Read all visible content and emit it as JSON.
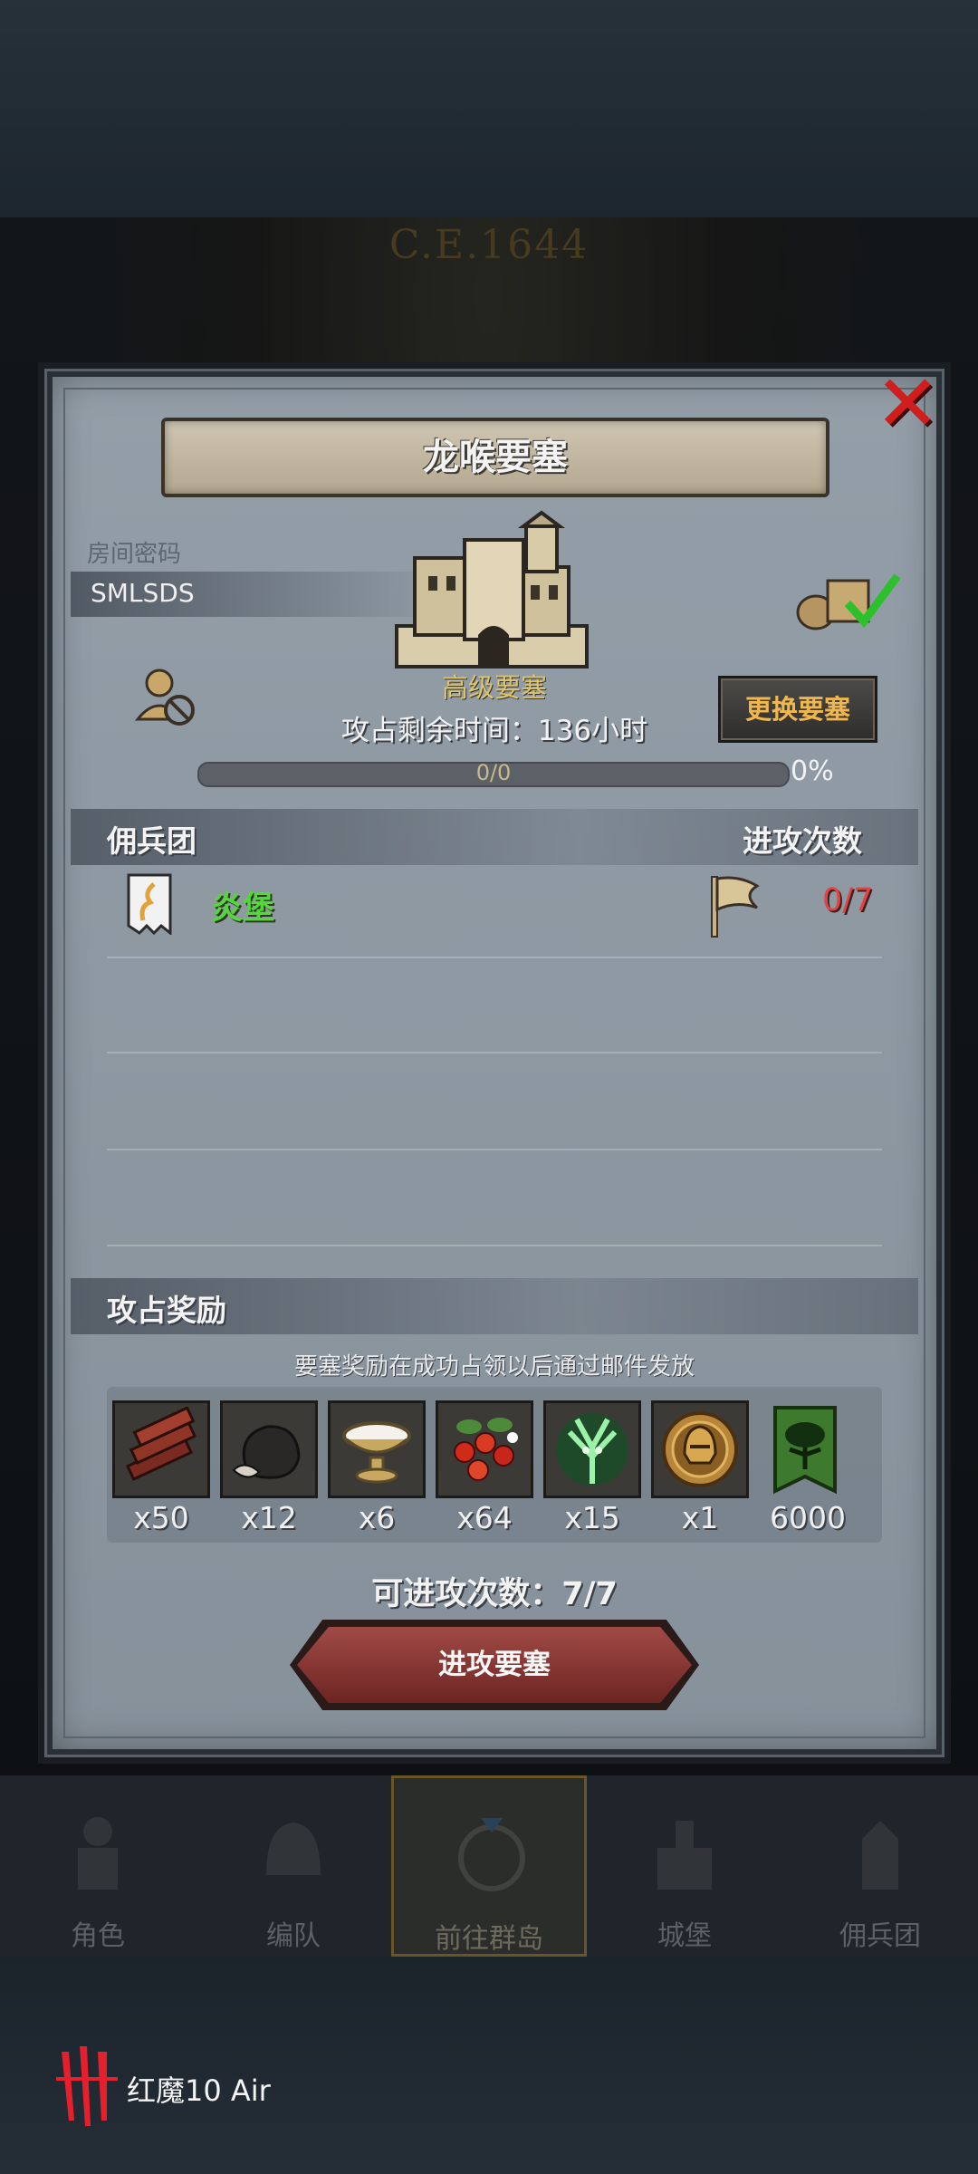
{
  "background": {
    "era_text": "C.E.1644"
  },
  "dialog": {
    "title": "龙喉要塞",
    "room_label": "房间密码",
    "room_code": "SMLSDS",
    "fortress_level": "高级要塞",
    "change_button": "更换要塞",
    "time_remaining": "攻占剩余时间：136小时",
    "progress_text": "0/0",
    "progress_percent": "0%",
    "progress_fraction": 0,
    "mercenary_header": "佣兵团",
    "attack_count_header": "进攻次数",
    "mercenary_name": "炎堡",
    "attack_count": "0/7",
    "rewards_header": "攻占奖励",
    "reward_note": "要塞奖励在成功占领以后通过邮件发放",
    "rewards": [
      {
        "icon": "wood-planks-icon",
        "qty": "x50"
      },
      {
        "icon": "ore-chunk-icon",
        "qty": "x12"
      },
      {
        "icon": "salt-bowl-icon",
        "qty": "x6"
      },
      {
        "icon": "berries-icon",
        "qty": "x64"
      },
      {
        "icon": "green-spirit-icon",
        "qty": "x15"
      },
      {
        "icon": "helmet-medal-icon",
        "qty": "x1"
      },
      {
        "icon": "tree-banner-icon",
        "qty": "6000"
      }
    ],
    "attacks_left": "可进攻次数：7/7",
    "attack_button": "进攻要塞"
  },
  "nav": {
    "items": [
      "角色",
      "编队",
      "前往群岛",
      "城堡",
      "佣兵团"
    ],
    "active_index": 2
  },
  "device": {
    "brand": "红魔10 Air"
  },
  "colors": {
    "accent_gold": "#f0b84c",
    "mercenary_green": "#55d63c",
    "attack_count_red": "#e04545",
    "close_red": "#d21d1d"
  }
}
